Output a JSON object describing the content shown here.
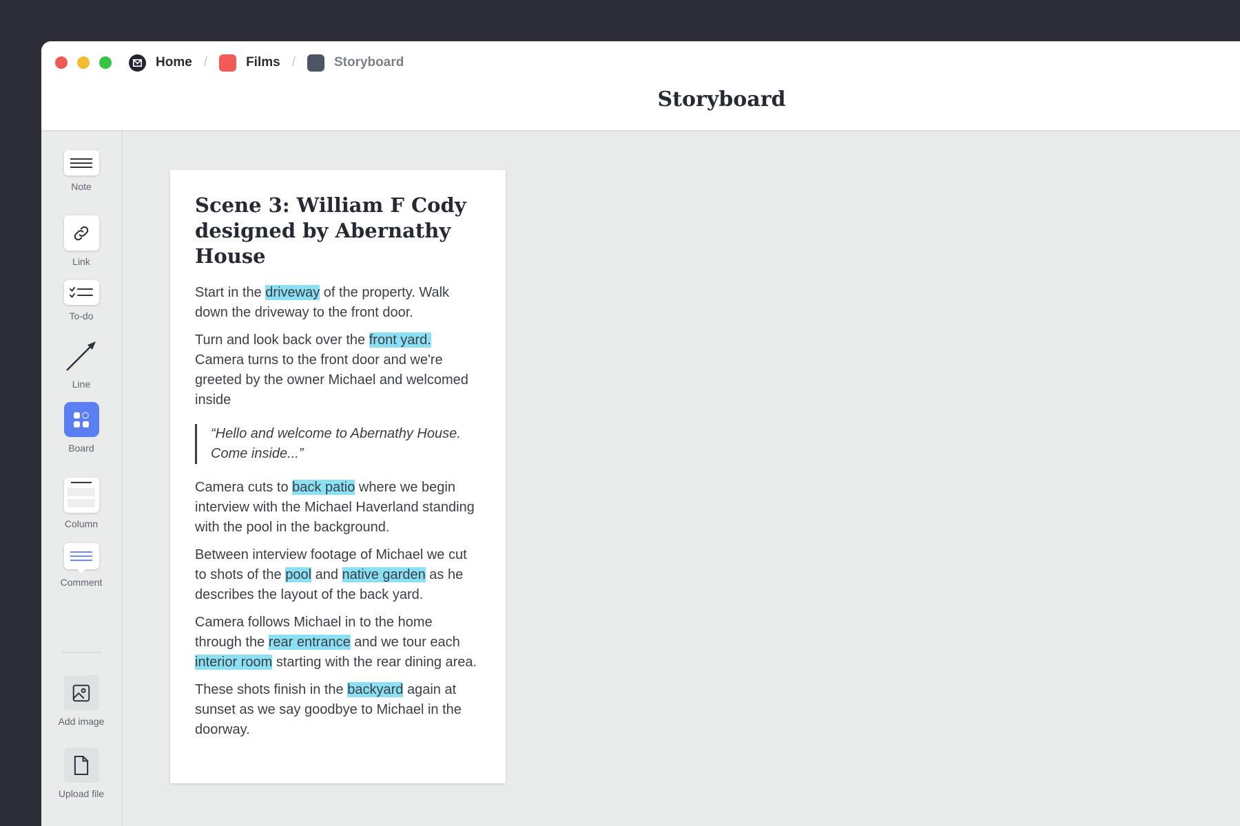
{
  "breadcrumbs": [
    {
      "label": "Home"
    },
    {
      "label": "Films"
    },
    {
      "label": "Storyboard"
    }
  ],
  "breadcrumb_separator": "/",
  "page_title": "Storyboard",
  "tools": {
    "note": "Note",
    "link": "Link",
    "todo": "To-do",
    "line": "Line",
    "board": "Board",
    "column": "Column",
    "comment": "Comment",
    "add_image": "Add image",
    "upload_file": "Upload file"
  },
  "colors": {
    "highlight": "#8be0f4",
    "board_accent": "#5b7ff2",
    "films_badge": "#f15a55",
    "storyboard_badge": "#4b5563"
  },
  "card": {
    "title": "Scene 3: William F Cody designed by Abernathy House",
    "p1": {
      "a": "Start in the ",
      "h1": "driveway",
      "b": " of the property. Walk down the driveway to the front door."
    },
    "p2": {
      "a": "Turn and look back over the ",
      "h1": "front yard.",
      "b": " Camera turns to the front door and we're greeted by the owner Michael and welcomed inside"
    },
    "quote": "“Hello and welcome to Abernathy House. Come inside...”",
    "p3": {
      "a": "Camera cuts to ",
      "h1": "back patio",
      "b": " where we begin interview with the Michael Haverland standing with the pool in the background."
    },
    "p4": {
      "a": "Between interview footage of Michael we cut to shots of the ",
      "h1": "pool",
      "b": " and ",
      "h2": "native garden",
      "c": " as he describes the layout of the back yard."
    },
    "p5": {
      "a": "Camera follows Michael in to the home through the ",
      "h1": "rear entrance",
      "b": " and we tour each ",
      "h2": "interior room",
      "c": " starting with the rear dining area."
    },
    "p6": {
      "a": "These shots finish in the ",
      "h1": "backyard",
      "b": " again at sunset as we say goodbye to Michael in the doorway."
    }
  }
}
